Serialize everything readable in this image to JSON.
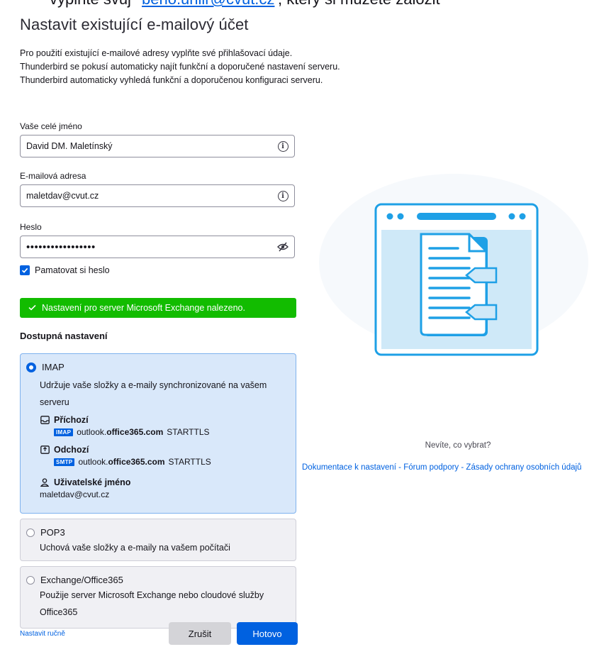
{
  "top_fragment": {
    "pre": "vyplnte svuj",
    "link": "beno.uhlir@cvut.cz",
    "post": ", ktery si muzete zalozit"
  },
  "title": "Nastavit existující e-mailový účet",
  "description": [
    "Pro použití existující e-mailové adresy vyplňte své přihlašovací údaje.",
    "Thunderbird se pokusí automaticky najít funkční a doporučené nastavení serveru.",
    "Thunderbird automaticky vyhledá funkční a doporučenou konfiguraci serveru."
  ],
  "form": {
    "name_label": "Vaše celé jméno",
    "name_value": "David DM. Maletínský",
    "email_label": "E-mailová adresa",
    "email_value": "maletdav@cvut.cz",
    "password_label": "Heslo",
    "password_value": "•••••••••••••••••",
    "remember_label": "Pamatovat si heslo",
    "remember_checked": true
  },
  "success_message": "Nastavení pro server Microsoft Exchange nalezeno.",
  "available_title": "Dostupná nastavení",
  "options": {
    "imap": {
      "name": "IMAP",
      "description": "Udržuje vaše složky a e-maily synchronizované na vašem serveru",
      "selected": true,
      "incoming_label": "Příchozí",
      "incoming_protocol": "IMAP",
      "incoming_host_prefix": "outlook.",
      "incoming_host_bold": "office365.com",
      "incoming_security": "STARTTLS",
      "outgoing_label": "Odchozí",
      "outgoing_protocol": "SMTP",
      "outgoing_host_prefix": "outlook.",
      "outgoing_host_bold": "office365.com",
      "outgoing_security": "STARTTLS",
      "username_label": "Uživatelské jméno",
      "username_value": "maletdav@cvut.cz"
    },
    "pop3": {
      "name": "POP3",
      "description": "Uchová vaše složky a e-maily na vašem počítači",
      "selected": false
    },
    "exchange": {
      "name": "Exchange/Office365",
      "description": "Použije server Microsoft Exchange nebo cloudové služby Office365",
      "selected": false
    }
  },
  "footer": {
    "manual_link": "Nastavit ručně",
    "cancel_label": "Zrušit",
    "done_label": "Hotovo"
  },
  "help": {
    "question": "Nevíte, co vybrat?",
    "links": [
      "Dokumentace k nastavení",
      "Fórum podpory",
      "Zásady ochrany osobních údajů"
    ],
    "separator": " - "
  },
  "colors": {
    "accent": "#0061e0",
    "success": "#12bc00",
    "selected_bg": "#d9e8fa",
    "illustration_stroke": "#1ea0e6",
    "illustration_fill": "#cfe9f8"
  },
  "icons": {
    "info": "info-icon",
    "password_toggle": "eye-slash-icon",
    "incoming": "inbox-icon",
    "outgoing": "outbox-icon",
    "user": "user-icon",
    "check": "check-icon"
  }
}
